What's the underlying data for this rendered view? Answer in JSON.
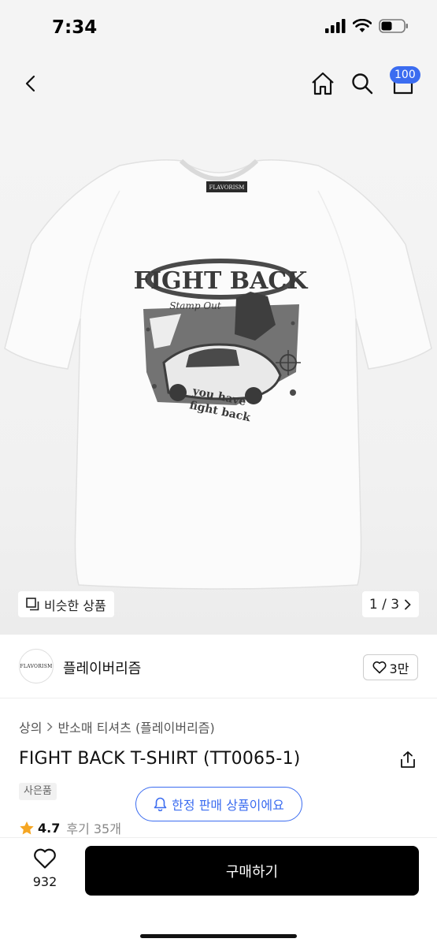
{
  "status": {
    "time": "7:34"
  },
  "nav": {
    "back_icon": "chevron-left-icon",
    "home_icon": "home-icon",
    "search_icon": "search-icon",
    "cart_icon": "cart-icon",
    "cart_count": "100"
  },
  "hero": {
    "product_image": "white-tshirt-fight-back-print",
    "print_title": "FIGHT BACK",
    "print_subtitle": "Stamp Out",
    "print_tagline_1": "you have",
    "print_tagline_2": "fight back",
    "tag_label": "FLAVORISM",
    "similar_label": "비슷한 상품",
    "pager": "1 / 3"
  },
  "brand": {
    "logo_text": "FLAVORISM",
    "name": "플레이버리즘",
    "likes": "3만"
  },
  "product": {
    "breadcrumb": [
      "상의",
      "반소매 티셔츠 (플레이버리즘)"
    ],
    "title": "FIGHT BACK T-SHIRT (TT0065-1)",
    "gift_badge": "사은품",
    "rating": "4.7",
    "reviews": "후기 35개",
    "limited_label": "한정 판매 상품이에요"
  },
  "bottom": {
    "wish_count": "932",
    "buy_label": "구매하기"
  },
  "colors": {
    "accent": "#3b6cf0",
    "buy_button": "#000000",
    "star": "#f5a623"
  }
}
